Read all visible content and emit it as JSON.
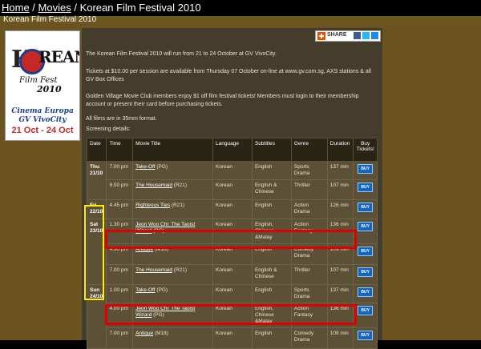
{
  "breadcrumb": {
    "home": "Home",
    "sep1": " / ",
    "movies": "Movies",
    "sep2": " / ",
    "current": "Korean Film Festival 2010"
  },
  "panel_title": "Korean Film Festival 2010",
  "poster": {
    "k": "K",
    "rean": "REAN",
    "film_fest": "Film Fest",
    "year": "2010",
    "line1": "Cinema Europa",
    "line2": "GV VivoCity",
    "dates": "21 Oct - 24 Oct"
  },
  "share": {
    "label": "SHARE"
  },
  "intro": [
    "The Korean Film Festival 2010 will run from 21 to 24 October at GV VivoCity.",
    "Tickets at $10.00 per session are available from Thursday 07 October on-line at www.gv.com.sg, AXS stations & all GV Box Offices",
    "Golden Village Movie Club members enjoy $1 off film festival tickets! Members must login to their membership account or present their card before purchasing tickets.",
    "All films are in 35mm format.",
    "Screening details:"
  ],
  "table": {
    "headers": {
      "date": "Date",
      "time": "Time",
      "title": "Movie Title",
      "language": "Language",
      "subtitles": "Subtitles",
      "genre": "Genre",
      "duration": "Duration",
      "buy": "Buy Tickets!"
    },
    "buy_label": "BUY",
    "rows": [
      {
        "date": "Thu 21/10",
        "time": "7.00 pm",
        "title": "Take-Off",
        "rating": " (PG)",
        "language": "Korean",
        "subtitles": "English",
        "genre": "Sports Drama",
        "duration": "137 min"
      },
      {
        "date": "",
        "time": "9.50 pm",
        "title": "The Housemaid",
        "rating": " (R21)",
        "language": "Korean",
        "subtitles": "English & Chinese",
        "genre": "Thriller",
        "duration": "107 min"
      },
      {
        "date": "Fri 22/10",
        "time": "4.45 pm",
        "title": "Righteous Ties",
        "rating": " (R21)",
        "language": "Korean",
        "subtitles": "English",
        "genre": "Action Drama",
        "duration": "126 min"
      },
      {
        "date": "Sat 23/10",
        "time": "1.30 pm",
        "title": "Jeon Woo Chi: The Taoist Wizard",
        "rating": " (PG)",
        "language": "Korean",
        "subtitles": "English, Chinese &Malay",
        "genre": "Action Fantasy",
        "duration": "136 min"
      },
      {
        "date": "",
        "time": "4.30 pm",
        "title": "Antique",
        "rating": " (M18)",
        "language": "Korean",
        "subtitles": "English",
        "genre": "Comedy Drama",
        "duration": "109 min"
      },
      {
        "date": "",
        "time": "7.00 pm",
        "title": "The Housemaid",
        "rating": " (R21)",
        "language": "Korean",
        "subtitles": "English & Chinese",
        "genre": "Thriller",
        "duration": "107 min"
      },
      {
        "date": "Sun 24/10",
        "time": "1.00 pm",
        "title": "Take-Off",
        "rating": " (PG)",
        "language": "Korean",
        "subtitles": "English",
        "genre": "Sports Drama",
        "duration": "137 min"
      },
      {
        "date": "",
        "time": "4.00 pm",
        "title": "Jeon Woo Chi: The Taoist Wizard",
        "rating": " (PG)",
        "language": "Korean",
        "subtitles": "English, Chinese &Malay",
        "genre": "Action Fantasy",
        "duration": "136 min"
      },
      {
        "date": "",
        "time": "7.00 pm",
        "title": "Antique",
        "rating": " (M18)",
        "language": "Korean",
        "subtitles": "English",
        "genre": "Comedy Drama",
        "duration": "109 min"
      }
    ]
  },
  "colors": {
    "highlight_yellow": "#ffee00",
    "highlight_red": "#e00000",
    "buy_blue": "#1565c0",
    "panel_brown": "#6b5420"
  }
}
